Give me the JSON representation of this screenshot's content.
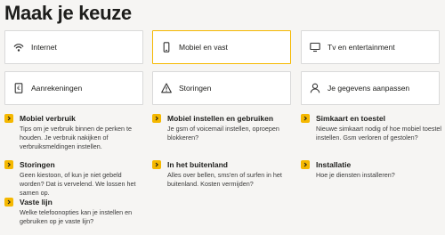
{
  "page": {
    "title": "Maak je keuze"
  },
  "tiles": [
    {
      "label": "Internet",
      "icon": "internet-icon"
    },
    {
      "label": "Mobiel en vast",
      "icon": "mobile-phone-icon",
      "active": true
    },
    {
      "label": "Tv en entertainment",
      "icon": "tv-icon"
    },
    {
      "label": "Aanrekeningen",
      "icon": "invoice-icon"
    },
    {
      "label": "Storingen",
      "icon": "warning-icon"
    },
    {
      "label": "Je gegevens aanpassen",
      "icon": "user-icon"
    }
  ],
  "topics": [
    {
      "title": "Mobiel verbruik",
      "desc": "Tips om je verbruik binnen de perken te houden. Je verbruik nakijken of verbruiksmeldingen instellen."
    },
    {
      "title": "Mobiel instellen en gebruiken",
      "desc": "Je gsm of voicemail instellen, oproepen blokkeren?"
    },
    {
      "title": "Simkaart en toestel",
      "desc": "Nieuwe simkaart nodig of hoe mobiel toestel instellen. Gsm verloren of gestolen?"
    },
    {
      "title": "Storingen",
      "desc": "Geen kiestoon, of kun je niet gebeld worden? Dat is vervelend. We lossen het samen op."
    },
    {
      "title": "In het buitenland",
      "desc": "Alles over bellen, sms'en of surfen in het buitenland. Kosten vermijden?"
    },
    {
      "title": "Installatie",
      "desc": "Hoe je diensten installeren?"
    },
    {
      "title": "Vaste lijn",
      "desc": "Welke telefoonopties kan je instellen en gebruiken op je vaste lijn?"
    }
  ],
  "colors": {
    "accent": "#f5b800",
    "text": "#1d1d1b",
    "background": "#f6f5f3"
  }
}
